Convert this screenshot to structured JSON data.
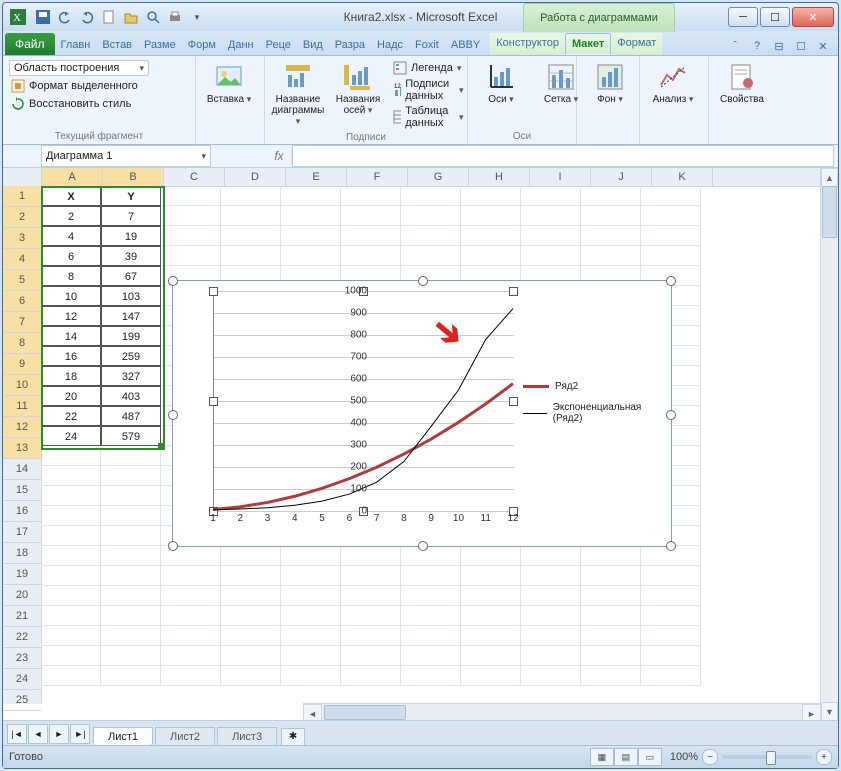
{
  "window": {
    "title_doc": "Книга2.xlsx",
    "title_app": "Microsoft Excel",
    "tools_title": "Работа с диаграммами",
    "minimize": "_",
    "maximize": "□",
    "close": "✕"
  },
  "qat": [
    "save-icon",
    "undo-icon",
    "redo-icon",
    "new-icon",
    "open-icon",
    "print-preview-icon",
    "quick-print-icon",
    "spellcheck-icon"
  ],
  "tabs": {
    "file": "Файл",
    "items": [
      "Главн",
      "Встав",
      "Разме",
      "Форм",
      "Данн",
      "Реце",
      "Вид",
      "Разра",
      "Надс",
      "Foxit",
      "ABBY"
    ],
    "chart_tools": [
      "Конструктор",
      "Макет",
      "Формат"
    ],
    "active": "Макет"
  },
  "ribbon": {
    "g1": {
      "select": "Область построения",
      "format_sel": "Формат выделенного",
      "reset": "Восстановить стиль",
      "label": "Текущий фрагмент"
    },
    "g2": {
      "insert": "Вставка"
    },
    "g3": {
      "chart_title": "Название\nдиаграммы",
      "axis_title": "Названия\nосей",
      "label": "Подписи"
    },
    "g3b": {
      "legend": "Легенда",
      "data_labels": "Подписи данных",
      "data_table": "Таблица данных"
    },
    "g4": {
      "axes": "Оси",
      "grid": "Сетка",
      "label": "Оси"
    },
    "g5": {
      "bg": "Фон"
    },
    "g6": {
      "analysis": "Анализ"
    },
    "g7": {
      "props": "Свойства"
    }
  },
  "namebox": "Диаграмма 1",
  "fx": "fx",
  "columns": [
    "A",
    "B",
    "C",
    "D",
    "E",
    "F",
    "G",
    "H",
    "I",
    "J",
    "K"
  ],
  "row_count": 25,
  "table": {
    "headers": {
      "x": "X",
      "y": "Y"
    },
    "rows": [
      {
        "x": 2,
        "y": 7
      },
      {
        "x": 4,
        "y": 19
      },
      {
        "x": 6,
        "y": 39
      },
      {
        "x": 8,
        "y": 67
      },
      {
        "x": 10,
        "y": 103
      },
      {
        "x": 12,
        "y": 147
      },
      {
        "x": 14,
        "y": 199
      },
      {
        "x": 16,
        "y": 259
      },
      {
        "x": 18,
        "y": 327
      },
      {
        "x": 20,
        "y": 403
      },
      {
        "x": 22,
        "y": 487
      },
      {
        "x": 24,
        "y": 579
      }
    ]
  },
  "chart_data": {
    "type": "line",
    "x": [
      1,
      2,
      3,
      4,
      5,
      6,
      7,
      8,
      9,
      10,
      11,
      12
    ],
    "series": [
      {
        "name": "Ряд2",
        "values": [
          7,
          19,
          39,
          67,
          103,
          147,
          199,
          259,
          327,
          403,
          487,
          579
        ],
        "color": "#b23a3a",
        "width": 3
      },
      {
        "name": "Экспоненциальная (Ряд2)",
        "values": [
          5,
          9,
          15,
          26,
          45,
          77,
          131,
          225,
          385,
          550,
          780,
          920
        ],
        "color": "#000",
        "width": 1
      }
    ],
    "ylim": [
      0,
      1000
    ],
    "ytick": 100,
    "xlabel": "",
    "ylabel": "",
    "title": "",
    "legend_pos": "right"
  },
  "sheets": {
    "active": "Лист1",
    "others": [
      "Лист2",
      "Лист3"
    ]
  },
  "status": {
    "ready": "Готово",
    "zoom": "100%"
  },
  "legend": {
    "s1": "Ряд2",
    "s2": "Экспоненциальная (Ряд2)"
  }
}
